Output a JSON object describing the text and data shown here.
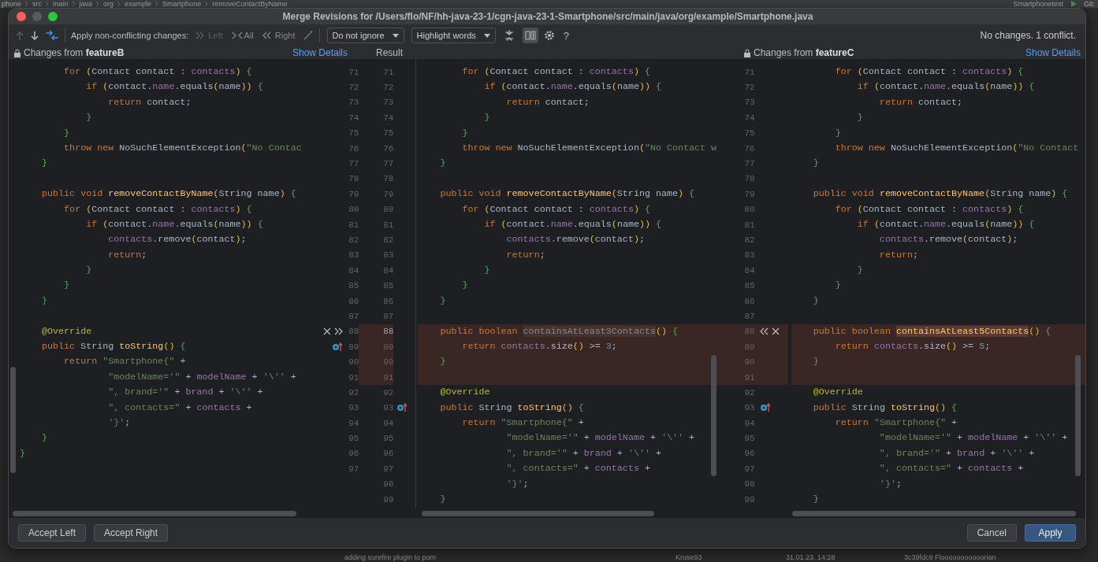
{
  "ide": {
    "breadcrumb": [
      "phone",
      "src",
      "main",
      "java",
      "org",
      "example",
      "Smartphone",
      "removeContactByName"
    ],
    "run_config": "Smartphonetest",
    "git_label": "Git:",
    "git_row": {
      "message": "adding surefire plugin to pom",
      "author": "Kruse93",
      "date": "31.01.23, 14:28",
      "commit": "3c39fdc9 Flooooooooooorian"
    }
  },
  "window": {
    "title": "Merge Revisions for /Users/flo/NF/hh-java-23-1/cgn-java-23-1-Smartphone/src/main/java/org/example/Smartphone.java"
  },
  "toolbar": {
    "nav": [
      {
        "disabled": true
      },
      {
        "disabled": false
      }
    ],
    "apply_label": "Apply non-conflicting changes:",
    "apply_buttons": [
      {
        "text": "Left",
        "disabled": true
      },
      {
        "text": "All",
        "disabled": false
      },
      {
        "text": "Right",
        "disabled": false
      }
    ],
    "dropdowns": [
      {
        "value": "Do not ignore"
      },
      {
        "value": "Highlight words"
      }
    ],
    "toggles": [
      {
        "selected": false
      },
      {
        "selected": true
      }
    ],
    "help": "?",
    "status": "No changes. 1 conflict."
  },
  "headers": {
    "left": {
      "title": "Changes from **featureB**",
      "link": "Show Details"
    },
    "result": {
      "title": "Result"
    },
    "right": {
      "title": "Changes from **featureC**",
      "link": "Show Details"
    }
  },
  "editors": {
    "left": {
      "lines": [
        {
          "number": "71",
          "conflict": false,
          "code": [
            {
              "kind": "kw",
              "text": "        for "
            },
            {
              "kind": "par",
              "text": "("
            },
            {
              "kind": "id",
              "text": "Contact contact : "
            },
            {
              "kind": "fld",
              "text": "contacts"
            },
            {
              "kind": "par",
              "text": ") "
            },
            {
              "kind": "brc",
              "text": "{"
            }
          ]
        },
        {
          "number": "72",
          "conflict": false,
          "code": [
            {
              "kind": "kw",
              "text": "            if "
            },
            {
              "kind": "par",
              "text": "("
            },
            {
              "kind": "id",
              "text": "contact."
            },
            {
              "kind": "fld",
              "text": "name"
            },
            {
              "kind": "id",
              "text": ".equals"
            },
            {
              "kind": "par",
              "text": "("
            },
            {
              "kind": "id",
              "text": "name"
            },
            {
              "kind": "par",
              "text": ")) "
            },
            {
              "kind": "brc",
              "text": "{"
            }
          ]
        },
        {
          "number": "73",
          "conflict": false,
          "code": [
            {
              "kind": "kw",
              "text": "                return "
            },
            {
              "kind": "id",
              "text": "contact;"
            }
          ]
        },
        {
          "number": "74",
          "conflict": false,
          "code": [
            {
              "kind": "brc",
              "text": "            }"
            }
          ]
        },
        {
          "number": "75",
          "conflict": false,
          "code": [
            {
              "kind": "brc",
              "text": "        }"
            }
          ]
        },
        {
          "number": "76",
          "conflict": false,
          "code": [
            {
              "kind": "kw",
              "text": "        throw new "
            },
            {
              "kind": "id",
              "text": "NoSuchElementException"
            },
            {
              "kind": "par",
              "text": "("
            },
            {
              "kind": "str",
              "text": "\"No Contac"
            }
          ]
        },
        {
          "number": "77",
          "conflict": false,
          "code": [
            {
              "kind": "brc",
              "text": "    }"
            }
          ]
        },
        {
          "number": "78",
          "conflict": false
        },
        {
          "number": "79",
          "conflict": false,
          "code": [
            {
              "kind": "kw",
              "text": "    public void "
            },
            {
              "kind": "fn",
              "text": "removeContactByName"
            },
            {
              "kind": "par",
              "text": "("
            },
            {
              "kind": "id",
              "text": "String name"
            },
            {
              "kind": "par",
              "text": ") "
            },
            {
              "kind": "brc",
              "text": "{"
            }
          ]
        },
        {
          "number": "80",
          "conflict": false,
          "code": [
            {
              "kind": "kw",
              "text": "        for "
            },
            {
              "kind": "par",
              "text": "("
            },
            {
              "kind": "id",
              "text": "Contact contact : "
            },
            {
              "kind": "fld",
              "text": "contacts"
            },
            {
              "kind": "par",
              "text": ") "
            },
            {
              "kind": "brc",
              "text": "{"
            }
          ]
        },
        {
          "number": "81",
          "conflict": false,
          "code": [
            {
              "kind": "kw",
              "text": "            if "
            },
            {
              "kind": "par",
              "text": "("
            },
            {
              "kind": "id",
              "text": "contact."
            },
            {
              "kind": "fld",
              "text": "name"
            },
            {
              "kind": "id",
              "text": ".equals"
            },
            {
              "kind": "par",
              "text": "("
            },
            {
              "kind": "id",
              "text": "name"
            },
            {
              "kind": "par",
              "text": ")) "
            },
            {
              "kind": "brc",
              "text": "{"
            }
          ]
        },
        {
          "number": "82",
          "conflict": false,
          "code": [
            {
              "kind": "fld",
              "text": "                contacts"
            },
            {
              "kind": "id",
              "text": ".remove"
            },
            {
              "kind": "par",
              "text": "("
            },
            {
              "kind": "id",
              "text": "contact"
            },
            {
              "kind": "par",
              "text": ")"
            },
            {
              "kind": "id",
              "text": ";"
            }
          ]
        },
        {
          "number": "83",
          "conflict": false,
          "code": [
            {
              "kind": "kw",
              "text": "                return"
            },
            {
              "kind": "id",
              "text": ";"
            }
          ]
        },
        {
          "number": "84",
          "conflict": false,
          "code": [
            {
              "kind": "brc",
              "text": "            }"
            }
          ]
        },
        {
          "number": "85",
          "conflict": false,
          "code": [
            {
              "kind": "brc",
              "text": "        }"
            }
          ]
        },
        {
          "number": "86",
          "conflict": false,
          "code": [
            {
              "kind": "brc",
              "text": "    }"
            }
          ]
        },
        {
          "number": "87",
          "conflict": false
        },
        {
          "number": "88",
          "conflict": false,
          "kind": "actions",
          "code": [
            {
              "kind": "ann",
              "text": "    @Override"
            }
          ]
        },
        {
          "number": "89",
          "conflict": false,
          "kind": "override",
          "code": [
            {
              "kind": "kw",
              "text": "    public "
            },
            {
              "kind": "id",
              "text": "String "
            },
            {
              "kind": "fn",
              "text": "toString"
            },
            {
              "kind": "par",
              "text": "() "
            },
            {
              "kind": "brc",
              "text": "{"
            }
          ]
        },
        {
          "number": "90",
          "conflict": false,
          "code": [
            {
              "kind": "kw",
              "text": "        return "
            },
            {
              "kind": "str",
              "text": "\"Smartphone{\""
            },
            {
              "kind": "id",
              "text": " +"
            }
          ]
        },
        {
          "number": "91",
          "conflict": false,
          "code": [
            {
              "kind": "str",
              "text": "                \"modelName='\""
            },
            {
              "kind": "id",
              "text": " + "
            },
            {
              "kind": "fld",
              "text": "modelName"
            },
            {
              "kind": "id",
              "text": " + "
            },
            {
              "kind": "str",
              "text": "'\\''"
            },
            {
              "kind": "id",
              "text": " +"
            }
          ]
        },
        {
          "number": "92",
          "conflict": false,
          "code": [
            {
              "kind": "str",
              "text": "                \", brand='\""
            },
            {
              "kind": "id",
              "text": " + "
            },
            {
              "kind": "fld",
              "text": "brand"
            },
            {
              "kind": "id",
              "text": " + "
            },
            {
              "kind": "str",
              "text": "'\\''"
            },
            {
              "kind": "id",
              "text": " +"
            }
          ]
        },
        {
          "number": "93",
          "conflict": false,
          "code": [
            {
              "kind": "str",
              "text": "                \", contacts=\""
            },
            {
              "kind": "id",
              "text": " + "
            },
            {
              "kind": "fld",
              "text": "contacts"
            },
            {
              "kind": "id",
              "text": " +"
            }
          ]
        },
        {
          "number": "94",
          "conflict": false,
          "code": [
            {
              "kind": "str",
              "text": "                '}'"
            },
            {
              "kind": "id",
              "text": ";"
            }
          ]
        },
        {
          "number": "95",
          "conflict": false,
          "code": [
            {
              "kind": "brc",
              "text": "    }"
            }
          ]
        },
        {
          "number": "96",
          "conflict": false,
          "code": [
            {
              "kind": "brc",
              "text": "}"
            }
          ]
        },
        {
          "number": "97",
          "conflict": false
        }
      ]
    },
    "result": {
      "lines": [
        {
          "number": "71",
          "conflict": false,
          "code": [
            {
              "kind": "kw",
              "text": "        for "
            },
            {
              "kind": "par",
              "text": "("
            },
            {
              "kind": "id",
              "text": "Contact contact : "
            },
            {
              "kind": "fld",
              "text": "contacts"
            },
            {
              "kind": "par",
              "text": ") "
            },
            {
              "kind": "brc",
              "text": "{"
            }
          ]
        },
        {
          "number": "72",
          "conflict": false,
          "code": [
            {
              "kind": "kw",
              "text": "            if "
            },
            {
              "kind": "par",
              "text": "("
            },
            {
              "kind": "id",
              "text": "contact."
            },
            {
              "kind": "fld",
              "text": "name"
            },
            {
              "kind": "id",
              "text": ".equals"
            },
            {
              "kind": "par",
              "text": "("
            },
            {
              "kind": "id",
              "text": "name"
            },
            {
              "kind": "par",
              "text": ")) "
            },
            {
              "kind": "brc",
              "text": "{"
            }
          ]
        },
        {
          "number": "73",
          "conflict": false,
          "code": [
            {
              "kind": "kw",
              "text": "                return "
            },
            {
              "kind": "id",
              "text": "contact;"
            }
          ]
        },
        {
          "number": "74",
          "conflict": false,
          "code": [
            {
              "kind": "brc",
              "text": "            }"
            }
          ]
        },
        {
          "number": "75",
          "conflict": false,
          "code": [
            {
              "kind": "brc",
              "text": "        }"
            }
          ]
        },
        {
          "number": "76",
          "conflict": false,
          "code": [
            {
              "kind": "kw",
              "text": "        throw new "
            },
            {
              "kind": "id",
              "text": "NoSuchElementException"
            },
            {
              "kind": "par",
              "text": "("
            },
            {
              "kind": "str",
              "text": "\"No Contact w"
            }
          ]
        },
        {
          "number": "77",
          "conflict": false,
          "code": [
            {
              "kind": "brc",
              "text": "    }"
            }
          ]
        },
        {
          "number": "78",
          "conflict": false
        },
        {
          "number": "79",
          "conflict": false,
          "code": [
            {
              "kind": "kw",
              "text": "    public void "
            },
            {
              "kind": "fn",
              "text": "removeContactByName"
            },
            {
              "kind": "par",
              "text": "("
            },
            {
              "kind": "id",
              "text": "String name"
            },
            {
              "kind": "par",
              "text": ") "
            },
            {
              "kind": "brc",
              "text": "{"
            }
          ]
        },
        {
          "number": "80",
          "conflict": false,
          "code": [
            {
              "kind": "kw",
              "text": "        for "
            },
            {
              "kind": "par",
              "text": "("
            },
            {
              "kind": "id",
              "text": "Contact contact : "
            },
            {
              "kind": "fld",
              "text": "contacts"
            },
            {
              "kind": "par",
              "text": ") "
            },
            {
              "kind": "brc",
              "text": "{"
            }
          ]
        },
        {
          "number": "81",
          "conflict": false,
          "code": [
            {
              "kind": "kw",
              "text": "            if "
            },
            {
              "kind": "par",
              "text": "("
            },
            {
              "kind": "id",
              "text": "contact."
            },
            {
              "kind": "fld",
              "text": "name"
            },
            {
              "kind": "id",
              "text": ".equals"
            },
            {
              "kind": "par",
              "text": "("
            },
            {
              "kind": "id",
              "text": "name"
            },
            {
              "kind": "par",
              "text": ")) "
            },
            {
              "kind": "brc",
              "text": "{"
            }
          ]
        },
        {
          "number": "82",
          "conflict": false,
          "code": [
            {
              "kind": "fld",
              "text": "                contacts"
            },
            {
              "kind": "id",
              "text": ".remove"
            },
            {
              "kind": "par",
              "text": "("
            },
            {
              "kind": "id",
              "text": "contact"
            },
            {
              "kind": "par",
              "text": ")"
            },
            {
              "kind": "id",
              "text": ";"
            }
          ]
        },
        {
          "number": "83",
          "conflict": false,
          "code": [
            {
              "kind": "kw",
              "text": "                return"
            },
            {
              "kind": "id",
              "text": ";"
            }
          ]
        },
        {
          "number": "84",
          "conflict": false,
          "code": [
            {
              "kind": "brc",
              "text": "            }"
            }
          ]
        },
        {
          "number": "85",
          "conflict": false,
          "code": [
            {
              "kind": "brc",
              "text": "        }"
            }
          ]
        },
        {
          "number": "86",
          "conflict": false,
          "code": [
            {
              "kind": "brc",
              "text": "    }"
            }
          ]
        },
        {
          "number": "87",
          "conflict": false
        },
        {
          "number": "88",
          "conflict": true,
          "code": [
            {
              "kind": "kw",
              "text": "    public boolean "
            },
            {
              "kind": "chg",
              "text": "containsAtLeast3Contacts"
            },
            {
              "kind": "par",
              "text": "() "
            },
            {
              "kind": "brc",
              "text": "{"
            }
          ]
        },
        {
          "number": "89",
          "conflict": true,
          "code": [
            {
              "kind": "kw",
              "text": "        return "
            },
            {
              "kind": "fld",
              "text": "contacts"
            },
            {
              "kind": "id",
              "text": ".size"
            },
            {
              "kind": "par",
              "text": "()"
            },
            {
              "kind": "id",
              "text": " >= "
            },
            {
              "kind": "num",
              "text": "3"
            },
            {
              "kind": "id",
              "text": ";"
            }
          ]
        },
        {
          "number": "90",
          "conflict": true,
          "code": [
            {
              "kind": "brc",
              "text": "    }"
            }
          ]
        },
        {
          "number": "91",
          "conflict": true
        },
        {
          "number": "92",
          "conflict": false,
          "code": [
            {
              "kind": "ann",
              "text": "    @Override"
            }
          ]
        },
        {
          "number": "93",
          "conflict": false,
          "kind": "override",
          "code": [
            {
              "kind": "kw",
              "text": "    public "
            },
            {
              "kind": "id",
              "text": "String "
            },
            {
              "kind": "fn",
              "text": "toString"
            },
            {
              "kind": "par",
              "text": "() "
            },
            {
              "kind": "brc",
              "text": "{"
            }
          ]
        },
        {
          "number": "94",
          "conflict": false,
          "code": [
            {
              "kind": "kw",
              "text": "        return "
            },
            {
              "kind": "str",
              "text": "\"Smartphone{\""
            },
            {
              "kind": "id",
              "text": " +"
            }
          ]
        },
        {
          "number": "95",
          "conflict": false,
          "code": [
            {
              "kind": "str",
              "text": "                \"modelName='\""
            },
            {
              "kind": "id",
              "text": " + "
            },
            {
              "kind": "fld",
              "text": "modelName"
            },
            {
              "kind": "id",
              "text": " + "
            },
            {
              "kind": "str",
              "text": "'\\''"
            },
            {
              "kind": "id",
              "text": " +"
            }
          ]
        },
        {
          "number": "96",
          "conflict": false,
          "code": [
            {
              "kind": "str",
              "text": "                \", brand='\""
            },
            {
              "kind": "id",
              "text": " + "
            },
            {
              "kind": "fld",
              "text": "brand"
            },
            {
              "kind": "id",
              "text": " + "
            },
            {
              "kind": "str",
              "text": "'\\''"
            },
            {
              "kind": "id",
              "text": " +"
            }
          ]
        },
        {
          "number": "97",
          "conflict": false,
          "code": [
            {
              "kind": "str",
              "text": "                \", contacts=\""
            },
            {
              "kind": "id",
              "text": " + "
            },
            {
              "kind": "fld",
              "text": "contacts"
            },
            {
              "kind": "id",
              "text": " +"
            }
          ]
        },
        {
          "number": "98",
          "conflict": false,
          "code": [
            {
              "kind": "str",
              "text": "                '}'"
            },
            {
              "kind": "id",
              "text": ";"
            }
          ]
        },
        {
          "number": "99",
          "conflict": false,
          "code": [
            {
              "kind": "brc",
              "text": "    }"
            }
          ]
        }
      ]
    },
    "right": {
      "lines": [
        {
          "number": "71",
          "conflict": false,
          "code": [
            {
              "kind": "kw",
              "text": "        for "
            },
            {
              "kind": "par",
              "text": "("
            },
            {
              "kind": "id",
              "text": "Contact contact : "
            },
            {
              "kind": "fld",
              "text": "contacts"
            },
            {
              "kind": "par",
              "text": ") "
            },
            {
              "kind": "brc",
              "text": "{"
            }
          ]
        },
        {
          "number": "72",
          "conflict": false,
          "code": [
            {
              "kind": "kw",
              "text": "            if "
            },
            {
              "kind": "par",
              "text": "("
            },
            {
              "kind": "id",
              "text": "contact."
            },
            {
              "kind": "fld",
              "text": "name"
            },
            {
              "kind": "id",
              "text": ".equals"
            },
            {
              "kind": "par",
              "text": "("
            },
            {
              "kind": "id",
              "text": "name"
            },
            {
              "kind": "par",
              "text": ")) "
            },
            {
              "kind": "brc",
              "text": "{"
            }
          ]
        },
        {
          "number": "73",
          "conflict": false,
          "code": [
            {
              "kind": "kw",
              "text": "                return "
            },
            {
              "kind": "id",
              "text": "contact;"
            }
          ]
        },
        {
          "number": "74",
          "conflict": false,
          "code": [
            {
              "kind": "brc",
              "text": "            }"
            }
          ]
        },
        {
          "number": "75",
          "conflict": false,
          "code": [
            {
              "kind": "brc",
              "text": "        }"
            }
          ]
        },
        {
          "number": "76",
          "conflict": false,
          "code": [
            {
              "kind": "kw",
              "text": "        throw new "
            },
            {
              "kind": "id",
              "text": "NoSuchElementException"
            },
            {
              "kind": "par",
              "text": "("
            },
            {
              "kind": "str",
              "text": "\"No Contact"
            }
          ]
        },
        {
          "number": "77",
          "conflict": false,
          "code": [
            {
              "kind": "brc",
              "text": "    }"
            }
          ]
        },
        {
          "number": "78",
          "conflict": false
        },
        {
          "number": "79",
          "conflict": false,
          "code": [
            {
              "kind": "kw",
              "text": "    public void "
            },
            {
              "kind": "fn",
              "text": "removeContactByName"
            },
            {
              "kind": "par",
              "text": "("
            },
            {
              "kind": "id",
              "text": "String name"
            },
            {
              "kind": "par",
              "text": ") "
            },
            {
              "kind": "brc",
              "text": "{"
            }
          ]
        },
        {
          "number": "80",
          "conflict": false,
          "code": [
            {
              "kind": "kw",
              "text": "        for "
            },
            {
              "kind": "par",
              "text": "("
            },
            {
              "kind": "id",
              "text": "Contact contact : "
            },
            {
              "kind": "fld",
              "text": "contacts"
            },
            {
              "kind": "par",
              "text": ") "
            },
            {
              "kind": "brc",
              "text": "{"
            }
          ]
        },
        {
          "number": "81",
          "conflict": false,
          "code": [
            {
              "kind": "kw",
              "text": "            if "
            },
            {
              "kind": "par",
              "text": "("
            },
            {
              "kind": "id",
              "text": "contact."
            },
            {
              "kind": "fld",
              "text": "name"
            },
            {
              "kind": "id",
              "text": ".equals"
            },
            {
              "kind": "par",
              "text": "("
            },
            {
              "kind": "id",
              "text": "name"
            },
            {
              "kind": "par",
              "text": ")) "
            },
            {
              "kind": "brc",
              "text": "{"
            }
          ]
        },
        {
          "number": "82",
          "conflict": false,
          "code": [
            {
              "kind": "fld",
              "text": "                contacts"
            },
            {
              "kind": "id",
              "text": ".remove"
            },
            {
              "kind": "par",
              "text": "("
            },
            {
              "kind": "id",
              "text": "contact"
            },
            {
              "kind": "par",
              "text": ")"
            },
            {
              "kind": "id",
              "text": ";"
            }
          ]
        },
        {
          "number": "83",
          "conflict": false,
          "code": [
            {
              "kind": "kw",
              "text": "                return"
            },
            {
              "kind": "id",
              "text": ";"
            }
          ]
        },
        {
          "number": "84",
          "conflict": false,
          "code": [
            {
              "kind": "brc",
              "text": "            }"
            }
          ]
        },
        {
          "number": "85",
          "conflict": false,
          "code": [
            {
              "kind": "brc",
              "text": "        }"
            }
          ]
        },
        {
          "number": "86",
          "conflict": false,
          "code": [
            {
              "kind": "brc",
              "text": "    }"
            }
          ]
        },
        {
          "number": "87",
          "conflict": false
        },
        {
          "number": "88",
          "conflict": true,
          "kind": "actions",
          "code": [
            {
              "kind": "kw",
              "text": "    public boolean "
            },
            {
              "kind": "fnchg",
              "text": "containsAtLeast5Contacts"
            },
            {
              "kind": "par",
              "text": "() "
            },
            {
              "kind": "brc",
              "text": "{"
            }
          ]
        },
        {
          "number": "89",
          "conflict": true,
          "code": [
            {
              "kind": "kw",
              "text": "        return "
            },
            {
              "kind": "fld",
              "text": "contacts"
            },
            {
              "kind": "id",
              "text": ".size"
            },
            {
              "kind": "par",
              "text": "()"
            },
            {
              "kind": "id",
              "text": " >= "
            },
            {
              "kind": "num",
              "text": "5"
            },
            {
              "kind": "id",
              "text": ";"
            }
          ]
        },
        {
          "number": "90",
          "conflict": true,
          "code": [
            {
              "kind": "brc",
              "text": "    }"
            }
          ]
        },
        {
          "number": "91",
          "conflict": true
        },
        {
          "number": "92",
          "conflict": false,
          "code": [
            {
              "kind": "ann",
              "text": "    @Override"
            }
          ]
        },
        {
          "number": "93",
          "conflict": false,
          "kind": "override",
          "code": [
            {
              "kind": "kw",
              "text": "    public "
            },
            {
              "kind": "id",
              "text": "String "
            },
            {
              "kind": "fn",
              "text": "toString"
            },
            {
              "kind": "par",
              "text": "() "
            },
            {
              "kind": "brc",
              "text": "{"
            }
          ]
        },
        {
          "number": "94",
          "conflict": false,
          "code": [
            {
              "kind": "kw",
              "text": "        return "
            },
            {
              "kind": "str",
              "text": "\"Smartphone{\""
            },
            {
              "kind": "id",
              "text": " +"
            }
          ]
        },
        {
          "number": "95",
          "conflict": false,
          "code": [
            {
              "kind": "str",
              "text": "                \"modelName='\""
            },
            {
              "kind": "id",
              "text": " + "
            },
            {
              "kind": "fld",
              "text": "modelName"
            },
            {
              "kind": "id",
              "text": " + "
            },
            {
              "kind": "str",
              "text": "'\\''"
            },
            {
              "kind": "id",
              "text": " +"
            }
          ]
        },
        {
          "number": "96",
          "conflict": false,
          "code": [
            {
              "kind": "str",
              "text": "                \", brand='\""
            },
            {
              "kind": "id",
              "text": " + "
            },
            {
              "kind": "fld",
              "text": "brand"
            },
            {
              "kind": "id",
              "text": " + "
            },
            {
              "kind": "str",
              "text": "'\\''"
            },
            {
              "kind": "id",
              "text": " +"
            }
          ]
        },
        {
          "number": "97",
          "conflict": false,
          "code": [
            {
              "kind": "str",
              "text": "                \", contacts=\""
            },
            {
              "kind": "id",
              "text": " + "
            },
            {
              "kind": "fld",
              "text": "contacts"
            },
            {
              "kind": "id",
              "text": " +"
            }
          ]
        },
        {
          "number": "98",
          "conflict": false,
          "code": [
            {
              "kind": "str",
              "text": "                '}'"
            },
            {
              "kind": "id",
              "text": ";"
            }
          ]
        },
        {
          "number": "99",
          "conflict": false,
          "code": [
            {
              "kind": "brc",
              "text": "    }"
            }
          ]
        }
      ]
    }
  },
  "footer": {
    "left_buttons": [
      {
        "text": "Accept Left"
      },
      {
        "text": "Accept Right"
      }
    ],
    "right_buttons": [
      {
        "text": "Cancel",
        "primary": false
      },
      {
        "text": "Apply",
        "primary": true
      }
    ]
  }
}
